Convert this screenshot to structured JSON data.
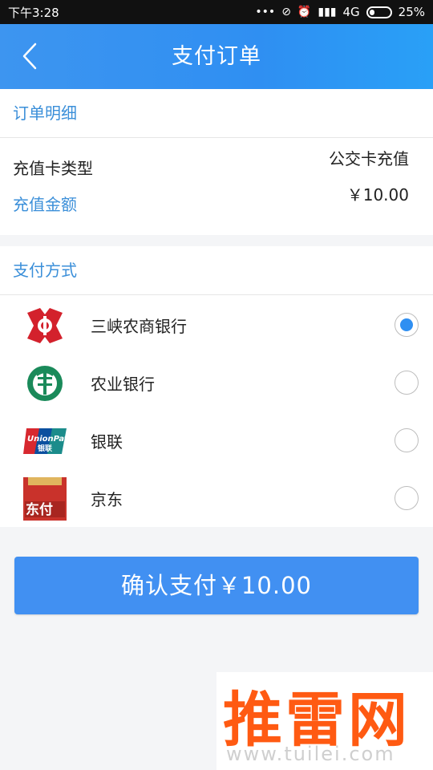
{
  "status": {
    "time": "下午3:28",
    "network": "4G",
    "battery": "25%"
  },
  "appbar": {
    "title": "支付订单"
  },
  "order": {
    "section_title": "订单明细",
    "card_type_label": "充值卡类型",
    "card_type_value": "公交卡充值",
    "amount_label": "充值金额",
    "amount_value": "￥10.00"
  },
  "payment": {
    "section_title": "支付方式",
    "methods": [
      {
        "name": "三峡农商银行",
        "icon": "three-gorges-bank-logo",
        "selected": true
      },
      {
        "name": "农业银行",
        "icon": "abc-bank-logo",
        "selected": false
      },
      {
        "name": "银联",
        "icon": "unionpay-logo",
        "selected": false
      },
      {
        "name": "京东",
        "icon": "jd-pay-logo",
        "selected": false
      }
    ]
  },
  "confirm": {
    "label": "确认支付￥10.00"
  },
  "watermark": {
    "main": "推雷网",
    "sub": "www.tuilei.com"
  },
  "colors": {
    "accent": "#2f8ff2",
    "section_title": "#3b8fd9",
    "watermark": "#ff5a12"
  }
}
